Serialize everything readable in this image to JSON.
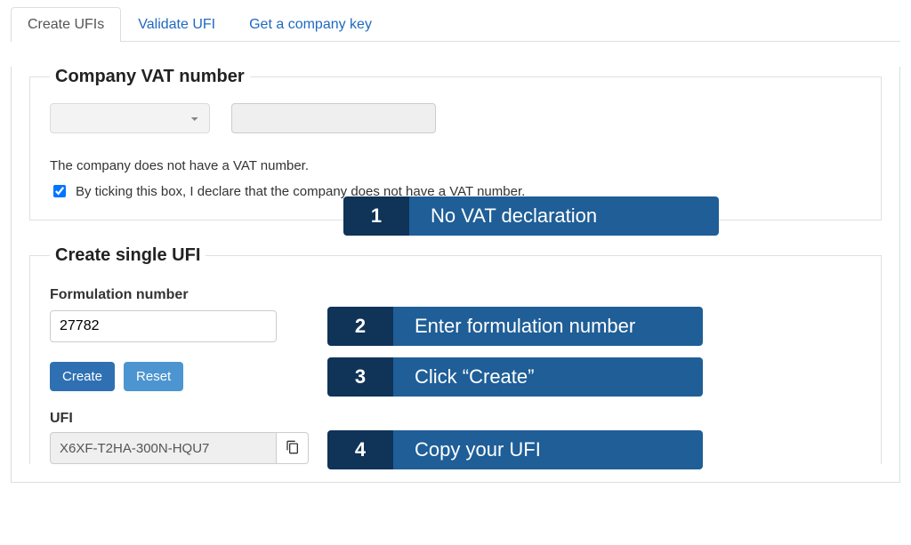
{
  "tabs": {
    "create": "Create UFIs",
    "validate": "Validate UFI",
    "company_key": "Get a company key"
  },
  "vat_section": {
    "legend": "Company VAT number",
    "country_selected": "",
    "vat_value": "",
    "no_vat_text": "The company does not have a VAT number.",
    "checkbox_checked": true,
    "checkbox_label": "By ticking this box, I declare that the company does not have a VAT number."
  },
  "single_ufi": {
    "legend": "Create single UFI",
    "formulation_label": "Formulation number",
    "formulation_value": "27782",
    "create_btn": "Create",
    "reset_btn": "Reset",
    "ufi_label": "UFI",
    "ufi_value": "X6XF-T2HA-300N-HQU7"
  },
  "callouts": {
    "c1": {
      "num": "1",
      "text": "No VAT declaration"
    },
    "c2": {
      "num": "2",
      "text": "Enter formulation number"
    },
    "c3": {
      "num": "3",
      "text": "Click “Create”"
    },
    "c4": {
      "num": "4",
      "text": "Copy your UFI"
    }
  }
}
